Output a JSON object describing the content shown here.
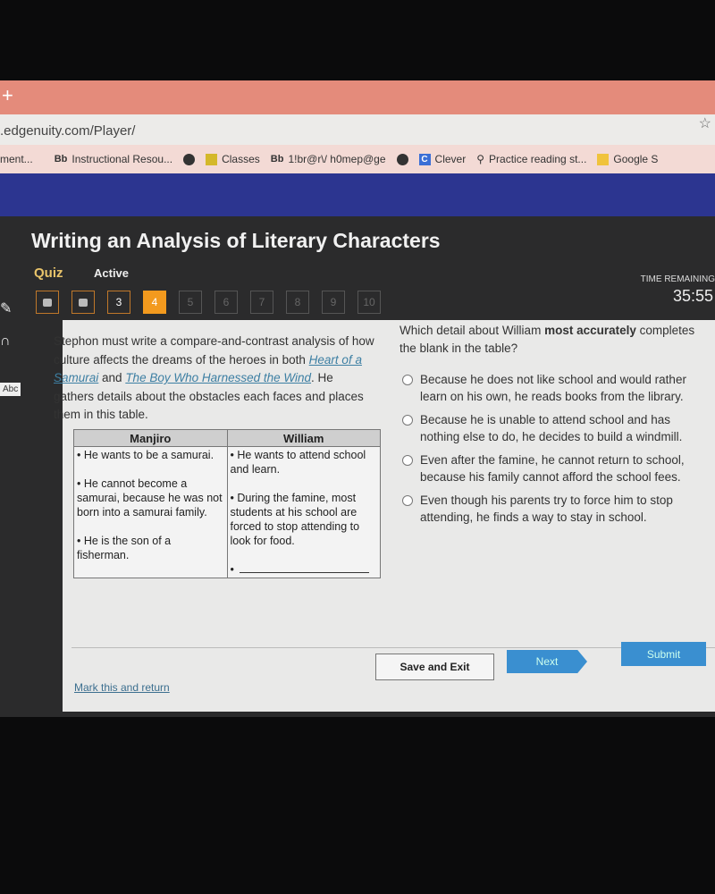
{
  "browser": {
    "new_tab": "+",
    "url": ".edgenuity.com/Player/",
    "bookmarks": [
      {
        "label": "ment...",
        "icon": ""
      },
      {
        "label": "Instructional Resou...",
        "icon": "Bb"
      },
      {
        "label": "",
        "icon": "globe"
      },
      {
        "label": "Classes",
        "icon": "classroom"
      },
      {
        "label": "1!br@r\\/ h0mep@ge",
        "icon": "Bb"
      },
      {
        "label": "",
        "icon": "globe"
      },
      {
        "label": "Clever",
        "icon": "C"
      },
      {
        "label": "Practice reading st...",
        "icon": "lamp"
      },
      {
        "label": "Google S",
        "icon": "folder"
      }
    ]
  },
  "header": {
    "title": "Writing an Analysis of Literary Characters",
    "type": "Quiz",
    "status": "Active",
    "time_label": "TIME REMAINING",
    "time": "35:55"
  },
  "question_nav": [
    {
      "label": "",
      "state": "locked"
    },
    {
      "label": "",
      "state": "locked"
    },
    {
      "label": "3",
      "state": "done"
    },
    {
      "label": "4",
      "state": "current"
    },
    {
      "label": "5",
      "state": "disabled"
    },
    {
      "label": "6",
      "state": "disabled"
    },
    {
      "label": "7",
      "state": "disabled"
    },
    {
      "label": "8",
      "state": "disabled"
    },
    {
      "label": "9",
      "state": "disabled"
    },
    {
      "label": "10",
      "state": "disabled"
    }
  ],
  "tools": {
    "abc": "Abc"
  },
  "passage": {
    "p1": "Stephon must write a compare-and-contrast analysis of how culture affects the dreams of the heroes in both ",
    "book1": "Heart of a Samurai",
    "p2": " and ",
    "book2": "The Boy Who Harnessed the Wind",
    "p3": ". He gathers details about the obstacles each faces and places them in this table."
  },
  "table": {
    "headers": [
      "Manjiro",
      "William"
    ],
    "manjiro": [
      "• He wants to be a samurai.",
      "• He cannot become a samurai, because he was not born into a samurai family.",
      "• He is the son of a fisherman."
    ],
    "william": [
      "• He wants to attend school and learn.",
      "• During the famine, most students at his school are forced to stop attending to look for food.",
      "•"
    ]
  },
  "question": {
    "pre": "Which detail about William ",
    "bold": "most accurately",
    "post": " completes the blank in the table?"
  },
  "options": [
    "Because he does not like school and would rather learn on his own, he reads books from the library.",
    "Because he is unable to attend school and has nothing else to do, he decides to build a windmill.",
    "Even after the famine, he cannot return to school, because his family cannot afford the school fees.",
    "Even though his parents try to force him to stop attending, he finds a way to stay in school."
  ],
  "footer": {
    "save": "Save and Exit",
    "next": "Next",
    "submit": "Submit",
    "mark": "Mark this and return"
  }
}
